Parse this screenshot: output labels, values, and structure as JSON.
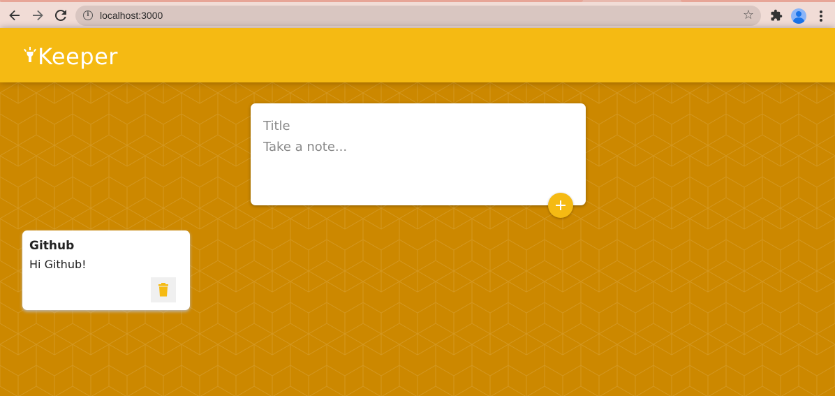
{
  "browser": {
    "url": "localhost:3000",
    "back_icon": "arrow-left-icon",
    "forward_icon": "arrow-right-icon",
    "reload_icon": "reload-icon",
    "info_icon": "info-icon",
    "bookmark_icon": "star-icon",
    "extensions_icon": "puzzle-icon",
    "profile_icon": "avatar-icon",
    "menu_icon": "kebab-menu-icon"
  },
  "header": {
    "title": "Keeper",
    "logo_icon": "highlight-icon",
    "background_color": "#f5ba13"
  },
  "create_area": {
    "title_placeholder": "Title",
    "content_placeholder": "Take a note...",
    "title_value": "",
    "content_value": "",
    "add_icon": "plus-icon"
  },
  "notes": [
    {
      "title": "Github",
      "content": "Hi Github!",
      "delete_icon": "trash-icon"
    }
  ],
  "colors": {
    "page_background": "#cc8800",
    "accent": "#f5ba13"
  }
}
